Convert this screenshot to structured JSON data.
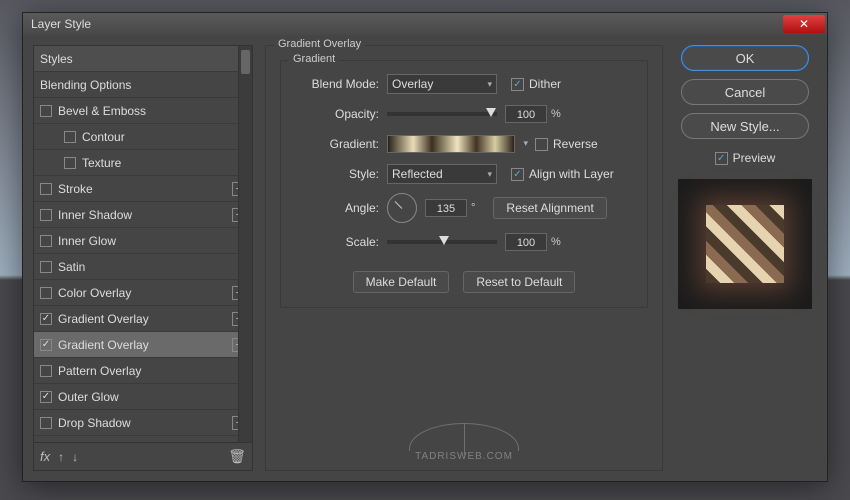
{
  "dialog": {
    "title": "Layer Style"
  },
  "styles_list": {
    "header": "Styles",
    "items": [
      {
        "label": "Blending Options",
        "checkbox": false,
        "checked": false,
        "plus": false,
        "indent": 0
      },
      {
        "label": "Bevel & Emboss",
        "checkbox": true,
        "checked": false,
        "plus": false,
        "indent": 0
      },
      {
        "label": "Contour",
        "checkbox": true,
        "checked": false,
        "plus": false,
        "indent": 1
      },
      {
        "label": "Texture",
        "checkbox": true,
        "checked": false,
        "plus": false,
        "indent": 1
      },
      {
        "label": "Stroke",
        "checkbox": true,
        "checked": false,
        "plus": true,
        "indent": 0
      },
      {
        "label": "Inner Shadow",
        "checkbox": true,
        "checked": false,
        "plus": true,
        "indent": 0
      },
      {
        "label": "Inner Glow",
        "checkbox": true,
        "checked": false,
        "plus": false,
        "indent": 0
      },
      {
        "label": "Satin",
        "checkbox": true,
        "checked": false,
        "plus": false,
        "indent": 0
      },
      {
        "label": "Color Overlay",
        "checkbox": true,
        "checked": false,
        "plus": true,
        "indent": 0
      },
      {
        "label": "Gradient Overlay",
        "checkbox": true,
        "checked": true,
        "plus": true,
        "indent": 0
      },
      {
        "label": "Gradient Overlay",
        "checkbox": true,
        "checked": true,
        "plus": true,
        "indent": 0,
        "selected": true
      },
      {
        "label": "Pattern Overlay",
        "checkbox": true,
        "checked": false,
        "plus": false,
        "indent": 0
      },
      {
        "label": "Outer Glow",
        "checkbox": true,
        "checked": true,
        "plus": false,
        "indent": 0
      },
      {
        "label": "Drop Shadow",
        "checkbox": true,
        "checked": false,
        "plus": true,
        "indent": 0
      }
    ],
    "footer": {
      "fx": "fx",
      "up": "↑",
      "down": "↓",
      "trash": "🗑"
    }
  },
  "panel": {
    "title": "Gradient Overlay",
    "group": "Gradient",
    "blend_label": "Blend Mode:",
    "blend_value": "Overlay",
    "dither_label": "Dither",
    "dither_on": true,
    "opacity_label": "Opacity:",
    "opacity_value": "100",
    "pct": "%",
    "gradient_label": "Gradient:",
    "reverse_label": "Reverse",
    "reverse_on": false,
    "style_label": "Style:",
    "style_value": "Reflected",
    "align_label": "Align with Layer",
    "align_on": true,
    "angle_label": "Angle:",
    "angle_value": "135",
    "deg": "°",
    "reset_align": "Reset Alignment",
    "scale_label": "Scale:",
    "scale_value": "100",
    "make_default": "Make Default",
    "reset_default": "Reset to Default"
  },
  "right": {
    "ok": "OK",
    "cancel": "Cancel",
    "new_style": "New Style...",
    "preview": "Preview",
    "preview_on": true
  },
  "watermark": "TADRISWEB.COM"
}
